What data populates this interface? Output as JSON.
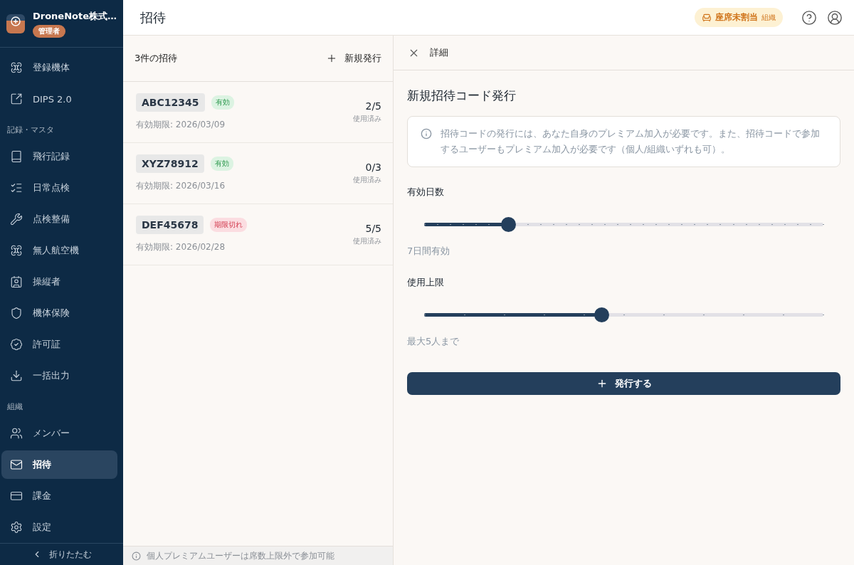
{
  "sidebar": {
    "org": {
      "name": "DroneNote株式…",
      "role": "管理者"
    },
    "sections": [
      {
        "items": [
          {
            "label": "登録機体",
            "selected": false
          },
          {
            "label": "DIPS 2.0",
            "selected": false
          }
        ]
      },
      {
        "heading": "記録・マスタ",
        "items": [
          {
            "label": "飛行記録",
            "selected": false
          },
          {
            "label": "日常点検",
            "selected": false
          },
          {
            "label": "点検整備",
            "selected": false
          },
          {
            "label": "無人航空機",
            "selected": false
          },
          {
            "label": "操縦者",
            "selected": false
          },
          {
            "label": "機体保険",
            "selected": false
          },
          {
            "label": "許可証",
            "selected": false
          },
          {
            "label": "一括出力",
            "selected": false
          }
        ]
      },
      {
        "heading": "組織",
        "items": [
          {
            "label": "メンバー",
            "selected": false
          },
          {
            "label": "招待",
            "selected": true
          },
          {
            "label": "課金",
            "selected": false
          },
          {
            "label": "設定",
            "selected": false
          }
        ]
      }
    ],
    "collapse": "折りたたむ"
  },
  "header": {
    "title": "招待",
    "seat_badge": {
      "label": "座席未割当",
      "scope": "組織"
    }
  },
  "list": {
    "count_label": "3件の招待",
    "new_button": "新規発行",
    "invites": [
      {
        "code": "ABC12345",
        "status": {
          "label": "有効",
          "kind": "active"
        },
        "expiry": "有効期限: 2026/03/09",
        "usage": "2/5",
        "usage_label": "使用済み"
      },
      {
        "code": "XYZ78912",
        "status": {
          "label": "有効",
          "kind": "active"
        },
        "expiry": "有効期限: 2026/03/16",
        "usage": "0/3",
        "usage_label": "使用済み"
      },
      {
        "code": "DEF45678",
        "status": {
          "label": "期限切れ",
          "kind": "expired"
        },
        "expiry": "有効期限: 2026/02/28",
        "usage": "5/5",
        "usage_label": "使用済み"
      }
    ],
    "footer_note": "個人プレミアムユーザーは席数上限外で参加可能"
  },
  "detail": {
    "title": "詳細",
    "heading": "新規招待コード発行",
    "notice": "招待コードの発行には、あなた自身のプレミアム加入が必要です。また、招待コードで参加するユーザーもプレミアム加入が必要です（個人/組織いずれも可）。",
    "sliders": [
      {
        "label": "有効日数",
        "level": 0.21,
        "reading": "7日間有効"
      },
      {
        "label": "使用上限",
        "level": 0.445,
        "reading": "最大5人まで"
      }
    ],
    "submit": "発行する"
  }
}
